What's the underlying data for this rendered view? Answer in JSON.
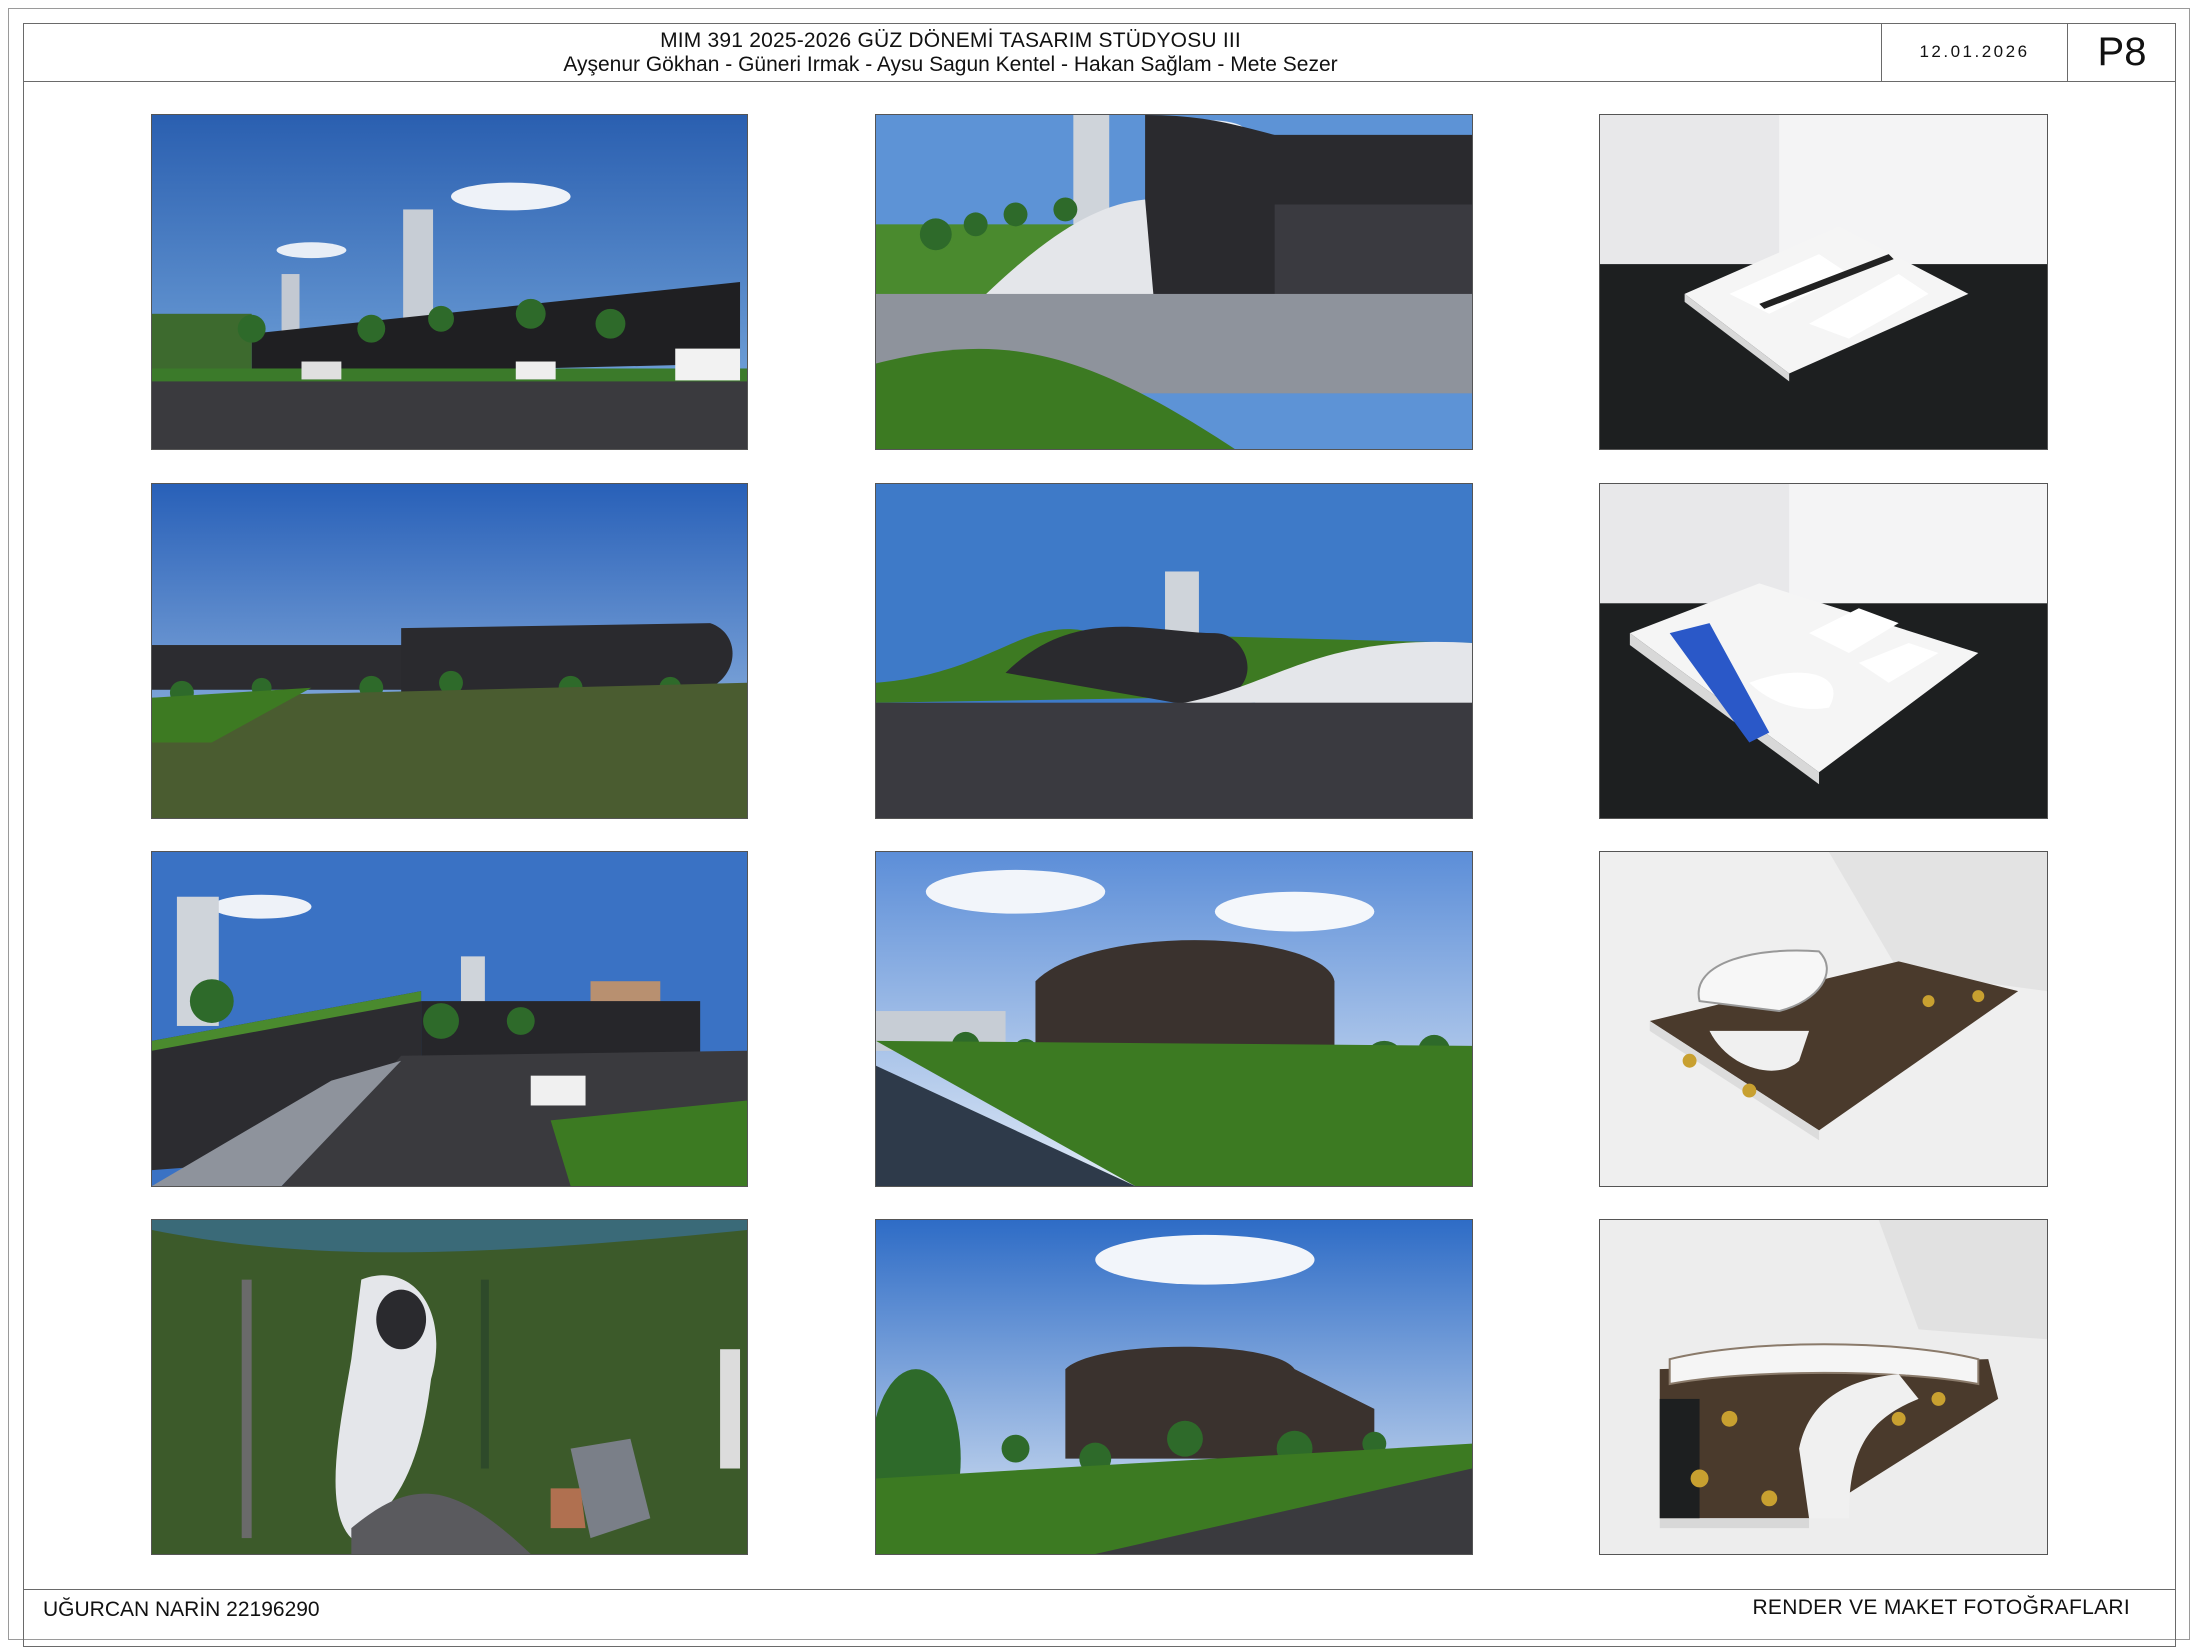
{
  "header": {
    "title": "MIM 391 2025-2026 GÜZ DÖNEMİ TASARIM  STÜDYOSU  III",
    "authors": "Ayşenur Gökhan - Güneri Irmak - Aysu Sagun Kentel - Hakan Sağlam - Mete Sezer",
    "date": "12.01.2026",
    "page": "P8"
  },
  "footer": {
    "student": "UĞURCAN NARİN 22196290",
    "sheet_title": "RENDER VE MAKET FOTOĞRAFLARI"
  }
}
